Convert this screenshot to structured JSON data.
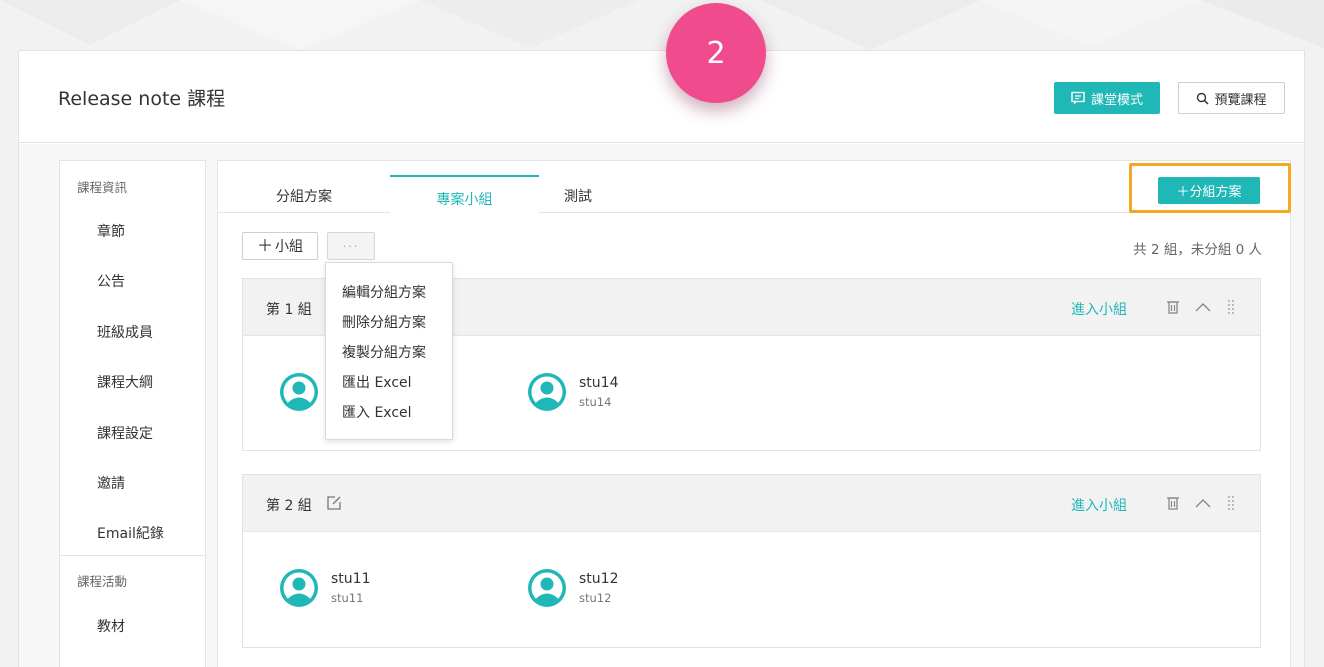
{
  "step_badge": "2",
  "header": {
    "title": "Release note 課程",
    "classroom_mode_label": "課堂模式",
    "preview_label": "預覽課程"
  },
  "sidebar": {
    "section_info": "課程資訊",
    "info_items": [
      "章節",
      "公告",
      "班級成員",
      "課程大綱",
      "課程設定",
      "邀請",
      "Email紀錄"
    ],
    "section_activity": "課程活動",
    "activity_items": [
      "教材"
    ]
  },
  "tabs": [
    {
      "label": "分組方案",
      "active": false
    },
    {
      "label": "專案小組",
      "active": true
    },
    {
      "label": "測試",
      "active": false
    }
  ],
  "toolbar": {
    "add_scheme_label": "＋分組方案",
    "add_group_label": "小組",
    "more_label": "···",
    "summary": "共 2 組，未分組 0 人"
  },
  "dropdown_menu": [
    "編輯分組方案",
    "刪除分組方案",
    "複製分組方案",
    "匯出 Excel",
    "匯入 Excel"
  ],
  "groups": [
    {
      "name": "第 1 組",
      "enter_label": "進入小組",
      "members": [
        {
          "name": "",
          "id": ""
        },
        {
          "name": "stu14",
          "id": "stu14"
        }
      ]
    },
    {
      "name": "第 2 組",
      "enter_label": "進入小組",
      "members": [
        {
          "name": "stu11",
          "id": "stu11"
        },
        {
          "name": "stu12",
          "id": "stu12"
        }
      ]
    }
  ],
  "colors": {
    "accent": "#20b7b7",
    "highlight_box": "#f5a623",
    "badge": "#ef4b8d"
  }
}
